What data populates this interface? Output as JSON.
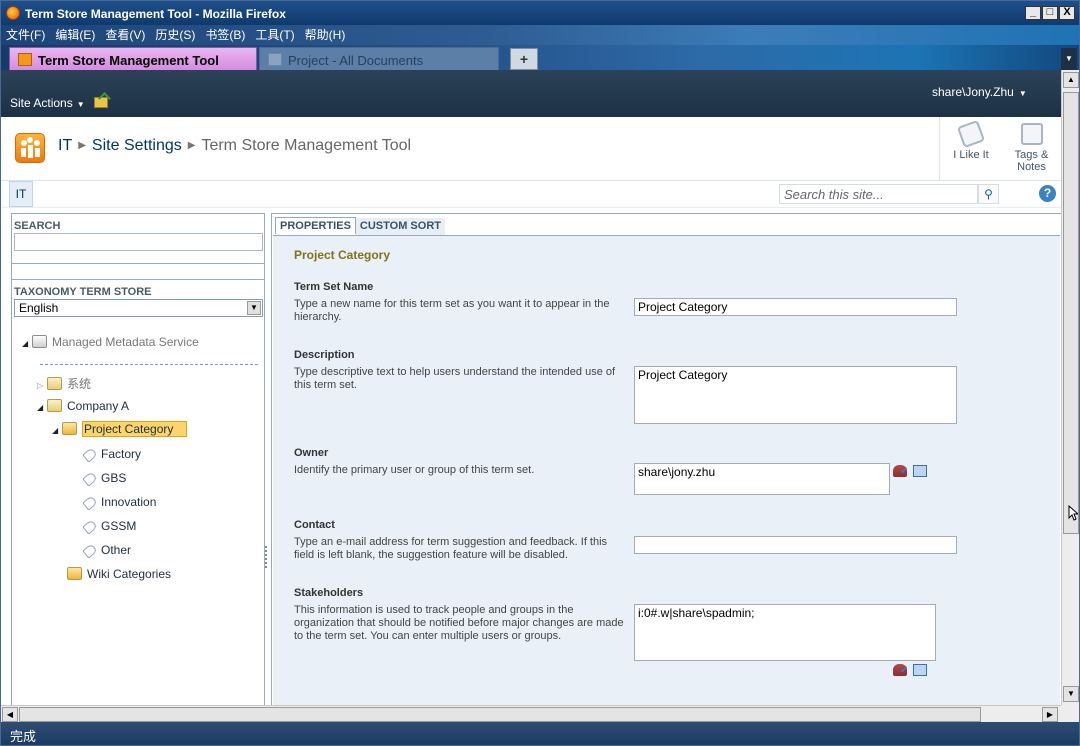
{
  "window": {
    "title": "Term Store Management Tool - Mozilla Firefox",
    "buttons": {
      "minimize": "_",
      "maximize": "□",
      "close": "X"
    }
  },
  "menubar": {
    "items": [
      "文件(F)",
      "编辑(E)",
      "查看(V)",
      "历史(S)",
      "书签(B)",
      "工具(T)",
      "帮助(H)"
    ]
  },
  "browser_tabs": [
    {
      "label": "Term Store Management Tool",
      "active": true
    },
    {
      "label": "Project - All Documents",
      "active": false
    }
  ],
  "new_tab_label": "+",
  "sharepoint": {
    "site_actions": "Site Actions",
    "user": "share\\Jony.Zhu",
    "breadcrumb": {
      "site": "IT",
      "settings": "Site Settings",
      "current": "Term Store Management Tool"
    },
    "i_like_it": "I Like It",
    "tags_notes": {
      "line1": "Tags &",
      "line2": "Notes"
    },
    "nav_tab": "IT",
    "search_placeholder": "Search this site...",
    "help": "?"
  },
  "left_pane": {
    "search_header": "SEARCH",
    "taxonomy_header": "TAXONOMY TERM STORE",
    "language": "English",
    "tree": {
      "root": "Managed Metadata Service",
      "group1": "系统",
      "group2": "Company A",
      "term_set": "Project Category",
      "terms": [
        "Factory",
        "GBS",
        "Innovation",
        "GSSM",
        "Other"
      ],
      "other_set": "Wiki Categories"
    }
  },
  "right_pane": {
    "tabs": {
      "properties": "PROPERTIES",
      "custom_sort": "CUSTOM SORT"
    },
    "section_title": "Project Category",
    "fields": {
      "term_set_name": {
        "label": "Term Set Name",
        "description": "Type a new name for this term set as you want it to appear in the hierarchy.",
        "value": "Project Category"
      },
      "description": {
        "label": "Description",
        "description": "Type descriptive text to help users understand the intended use of this term set.",
        "value": "Project Category"
      },
      "owner": {
        "label": "Owner",
        "description": "Identify the primary user or group of this term set.",
        "value": "share\\jony.zhu"
      },
      "contact": {
        "label": "Contact",
        "description": "Type an e-mail address for term suggestion and feedback. If this field is left blank, the suggestion feature will be disabled.",
        "value": ""
      },
      "stakeholders": {
        "label": "Stakeholders",
        "description": "This information is used to track people and groups in the organization that should be notified before major changes are made to the term set. You can enter multiple users or groups.",
        "value": "i:0#.w|share\\spadmin;"
      }
    }
  },
  "status": "完成",
  "colors": {
    "accent_tab": "#d58be0",
    "sp_header": "#2b4258",
    "section_title": "#7f7319",
    "body_bg": "#e9f0f8"
  }
}
